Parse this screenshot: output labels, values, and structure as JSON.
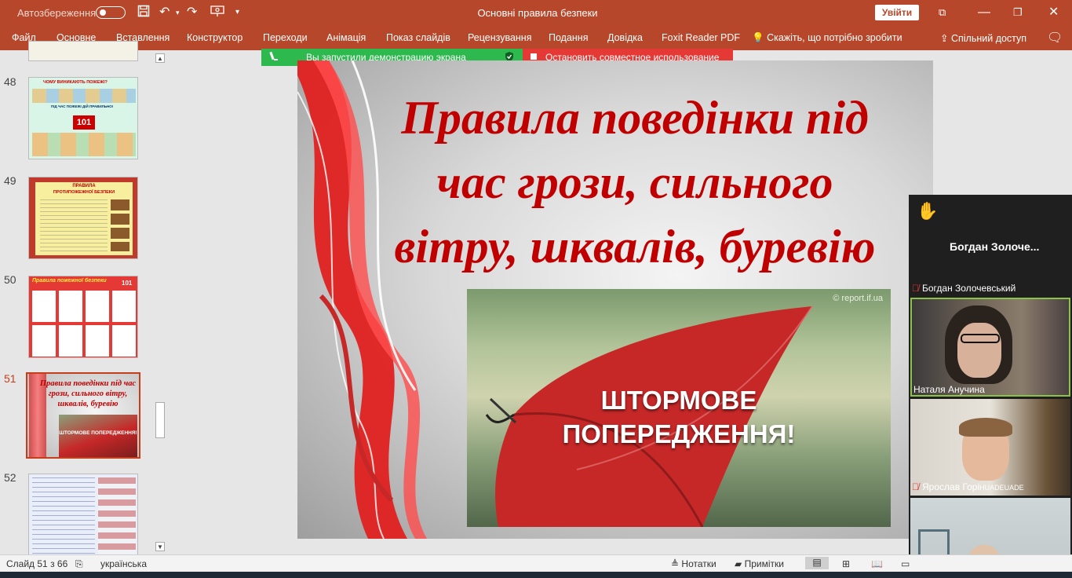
{
  "titlebar": {
    "autosave_label": "Автозбереження",
    "doc_title": "Основні правила безпеки",
    "signin_label": "Увійти",
    "icons": [
      "save-icon",
      "undo-icon",
      "redo-icon",
      "present-icon",
      "customize-icon",
      "restore-icon",
      "minimize-icon",
      "maximize-icon",
      "close-icon"
    ]
  },
  "ribbon": {
    "tabs": [
      "Файл",
      "Основне",
      "Вставлення",
      "Конструктор",
      "Переходи",
      "Анімація",
      "Показ слайдів",
      "Рецензування",
      "Подання",
      "Довідка",
      "Foxit Reader PDF",
      "Скажіть, що потрібно зробити"
    ],
    "share_label": "Спільний доступ"
  },
  "screenshare": {
    "sharing_text": "Вы запустили демонстрацию экрана",
    "stop_text": "Остановить совместное использование"
  },
  "thumbnails": [
    {
      "num": "48",
      "title": "ЧОМУ ВИНИКАЮТЬ ПОЖЕЖІ?",
      "subtitle": "ПІД ЧАС ПОЖЕЖІ ДІЙ ПРАВИЛЬНО!",
      "badge": "101"
    },
    {
      "num": "49",
      "title": "ПРАВИЛА",
      "subtitle": "ПРОТИПОЖЕЖНОЇ БЕЗПЕКИ"
    },
    {
      "num": "50",
      "title": "Правила пожежної безпеки",
      "badge": "101"
    },
    {
      "num": "51",
      "title": "Правила поведінки під час грози, сильного вітру, шквалів, буревію",
      "caption": "ШТОРМОВЕ ПОПЕРЕДЖЕННЯ!"
    },
    {
      "num": "52"
    }
  ],
  "slide": {
    "title_line1": "Правила поведінки під",
    "title_line2": "час грози, сильного",
    "title_line3": "вітру, шквалів, буревію",
    "photo_credit": "© report.if.ua",
    "photo_line1": "ШТОРМОВЕ",
    "photo_line2": "ПОПЕРЕДЖЕННЯ!"
  },
  "participants": {
    "header_name": "Богдан  Золоче...",
    "list": [
      {
        "name": "Богдан Золочевський",
        "muted": true
      },
      {
        "name": "Наталя Анучина",
        "muted": false
      },
      {
        "name": "Ярослав Горі",
        "suffix": "HUADEUADE",
        "muted": true
      }
    ]
  },
  "statusbar": {
    "slide_info": "Слайд 51 з 66",
    "language": "українська",
    "notes_label": "Нотатки",
    "comments_label": "Примітки"
  },
  "colors": {
    "accent": "#b7472a",
    "title_red": "#c00000",
    "share_green": "#2eb94f",
    "share_red": "#e53935"
  }
}
